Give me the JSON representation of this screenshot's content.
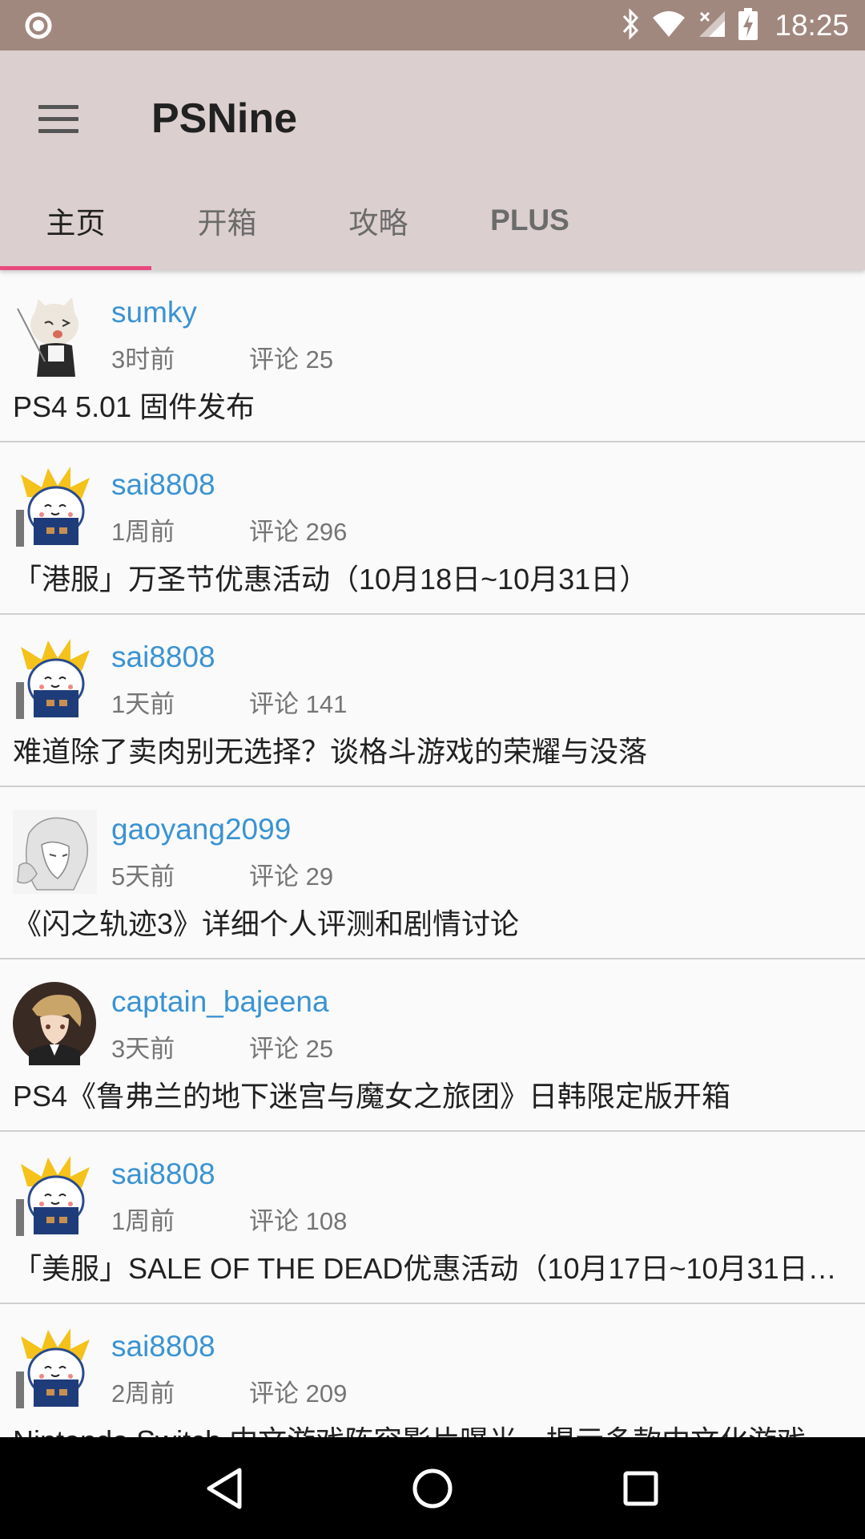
{
  "status_bar": {
    "time": "18:25",
    "icons": [
      "notification-circle-icon",
      "bluetooth-icon",
      "wifi-icon",
      "signal-icon",
      "battery-charging-icon"
    ]
  },
  "app_bar": {
    "menu_icon": "hamburger-menu-icon",
    "title": "PSNine"
  },
  "tabs": [
    {
      "label": "主页",
      "active": true
    },
    {
      "label": "开箱",
      "active": false
    },
    {
      "label": "攻略",
      "active": false
    },
    {
      "label": "PLUS",
      "active": false
    }
  ],
  "feed": [
    {
      "username": "sumky",
      "time": "3时前",
      "comments": "评论 25",
      "title": "PS4 5.01 固件发布"
    },
    {
      "username": "sai8808",
      "time": "1周前",
      "comments": "评论 296",
      "title": "「港服」万圣节优惠活动（10月18日~10月31日）"
    },
    {
      "username": "sai8808",
      "time": "1天前",
      "comments": "评论 141",
      "title": "难道除了卖肉别无选择？谈格斗游戏的荣耀与没落"
    },
    {
      "username": "gaoyang2099",
      "time": "5天前",
      "comments": "评论 29",
      "title": "《闪之轨迹3》详细个人评测和剧情讨论"
    },
    {
      "username": "captain_bajeena",
      "time": "3天前",
      "comments": "评论 25",
      "title": "PS4《鲁弗兰的地下迷宫与魔女之旅团》日韩限定版开箱"
    },
    {
      "username": "sai8808",
      "time": "1周前",
      "comments": "评论 108",
      "title": "「美服」SALE OF THE DEAD优惠活动（10月17日~10月31日…"
    },
    {
      "username": "sai8808",
      "time": "2周前",
      "comments": "评论 209",
      "title": "Nintendo Switch 中文游戏阵容影片曝光，提示多款中文化游戏"
    }
  ],
  "colors": {
    "status_bar": "#a1887f",
    "app_bar": "#dccfcf",
    "tab_indicator": "#e84a7f",
    "username": "#3a93d2"
  },
  "nav_bar": {
    "icons": [
      "back-triangle-icon",
      "home-circle-icon",
      "recents-square-icon"
    ]
  }
}
